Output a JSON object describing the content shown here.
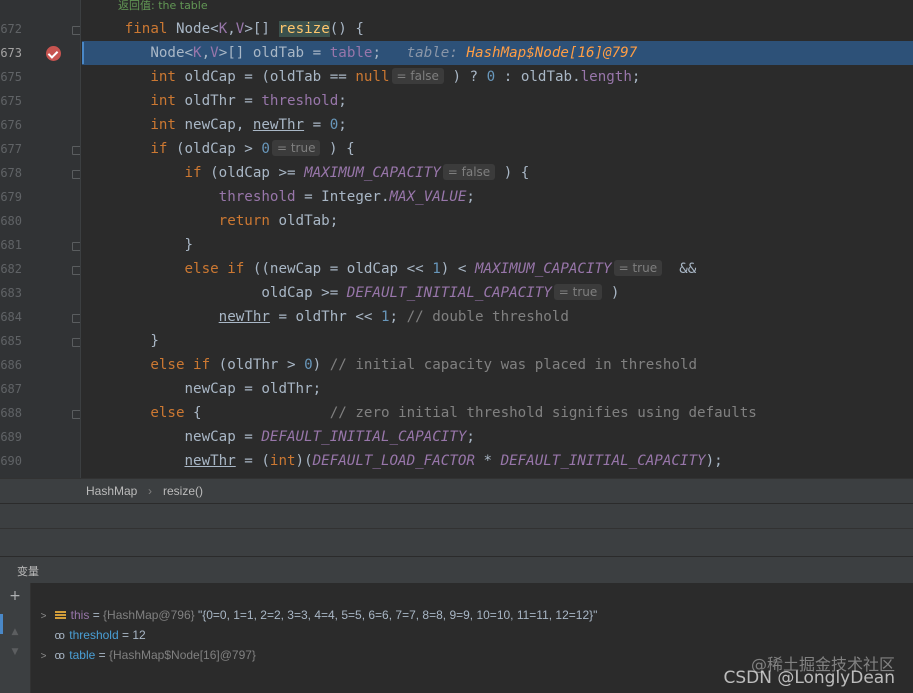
{
  "editor": {
    "doc_comment": "返回值: the table",
    "lines": [
      {
        "num": "672"
      },
      {
        "num": "673"
      },
      {
        "num": "675"
      },
      {
        "num": "675"
      },
      {
        "num": "676"
      },
      {
        "num": "677"
      },
      {
        "num": "678"
      },
      {
        "num": "679"
      },
      {
        "num": "680"
      },
      {
        "num": "681"
      },
      {
        "num": "682"
      },
      {
        "num": "683"
      },
      {
        "num": "684"
      },
      {
        "num": "685"
      },
      {
        "num": "686"
      },
      {
        "num": "687"
      },
      {
        "num": "688"
      },
      {
        "num": "689"
      },
      {
        "num": "690"
      }
    ],
    "hints": {
      "old_tab_null": "= false",
      "old_cap_gt0": "= true",
      "max_cap": "= false",
      "max_cap2": "= true",
      "default_cap": "= true"
    },
    "inline_debug": {
      "label": "table:",
      "value": "HashMap$Node[16]@797"
    },
    "comments": {
      "double_threshold": "// double threshold",
      "initial_capacity": "// initial capacity was placed in threshold",
      "zero_initial": "// zero initial threshold signifies using defaults"
    }
  },
  "breadcrumb": {
    "class_name": "HashMap",
    "separator": "›",
    "method_name": "resize()"
  },
  "variables_panel": {
    "title": "变量",
    "rows": [
      {
        "name": "this",
        "eq": " = ",
        "meta": "{HashMap@796}",
        "value": " \"{0=0, 1=1, 2=2, 3=3, 4=4, 5=5, 6=6, 7=7, 8=8, 9=9, 10=10, 11=11, 12=12}\""
      },
      {
        "name": "threshold",
        "eq": " = ",
        "value": "12"
      },
      {
        "name": "table",
        "eq": " = ",
        "meta": "{HashMap$Node[16]@797}"
      }
    ]
  },
  "watermark": {
    "line1": "@稀土掘金技术社区",
    "line2": "CSDN @LonglyDean"
  }
}
